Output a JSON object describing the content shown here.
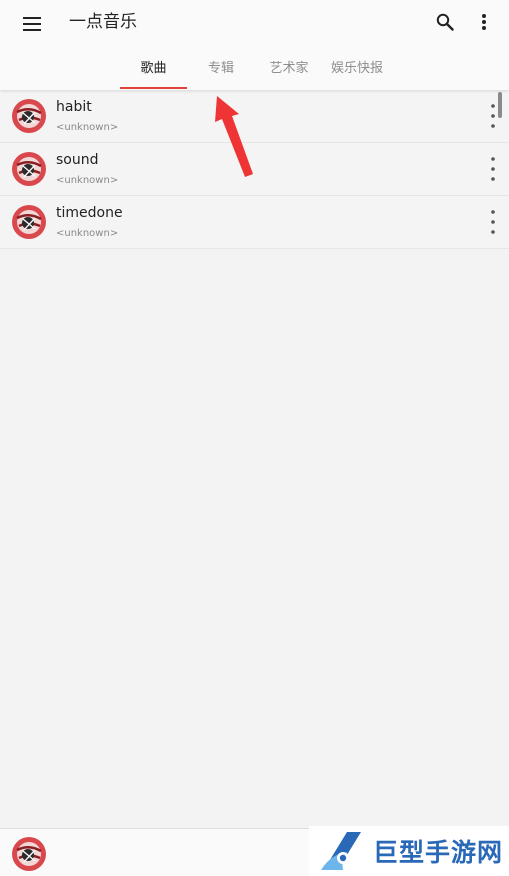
{
  "app": {
    "title": "一点音乐"
  },
  "toolbar": {
    "menu_icon": "hamburger-menu-icon",
    "search_icon": "search-icon",
    "more_icon": "more-vert-icon"
  },
  "tabs": [
    {
      "label": "歌曲",
      "active": true
    },
    {
      "label": "专辑",
      "active": false
    },
    {
      "label": "艺术家",
      "active": false
    },
    {
      "label": "娱乐快报",
      "active": false
    }
  ],
  "songs": [
    {
      "title": "habit",
      "artist": "<unknown>"
    },
    {
      "title": "sound",
      "artist": "<unknown>"
    },
    {
      "title": "timedone",
      "artist": "<unknown>"
    }
  ],
  "watermark": {
    "text": "巨型手游网"
  },
  "colors": {
    "accent": "#e0413a",
    "arrow": "#ee3434",
    "watermark": "#2a68b8"
  }
}
